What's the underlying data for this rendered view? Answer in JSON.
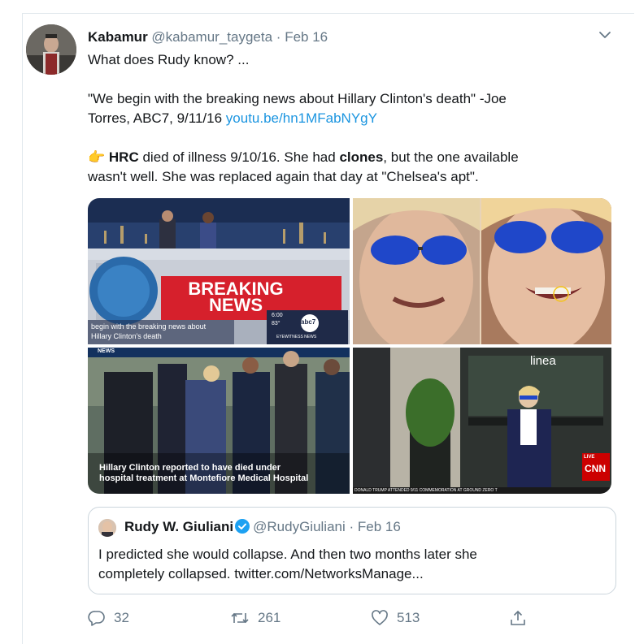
{
  "tweet": {
    "author_name": "Kabamur",
    "author_handle": "@kabamur_taygeta",
    "separator": "·",
    "date": "Feb 16",
    "line1": "What does Rudy know? ...",
    "quote_line1": "\"We begin with the breaking news about Hillary Clinton's death\" -Joe",
    "quote_line2_prefix": "Torres, ABC7, 9/11/16",
    "quote_link": "youtu.be/hn1MFabNYgY",
    "bullet_emoji": "👉",
    "hrc": "HRC",
    "line3_mid": " died of illness 9/10/16. She had ",
    "clones": "clones",
    "line3_end": ", but the one available",
    "line4": "wasn't well. She was replaced again that day at \"Chelsea's apt\"."
  },
  "media": {
    "image1": {
      "title_top": "BREAKING",
      "title_bottom": "NEWS",
      "caption_line1": "begin with the breaking news about",
      "caption_line2": "Hillary Clinton's death",
      "channel_logo": "abc7",
      "time": "6:00",
      "temp": "83°",
      "show_name": "EYEWITNESS NEWS"
    },
    "image3": {
      "nav_brand": "NEWS",
      "caption_line1": "Hillary Clinton reported to have died under",
      "caption_line2": "hospital treatment at Montefiore Medical Hospital"
    },
    "image4": {
      "storefront_sign": "linea",
      "live": "LIVE",
      "network": "CNN",
      "ticker": "DONALD TRUMP ATTENDED 9/11 COMMEMORATION AT GROUND ZERO T"
    }
  },
  "quoted_tweet": {
    "author_name": "Rudy W. Giuliani",
    "author_handle": "@RudyGiuliani",
    "separator": "·",
    "date": "Feb 16",
    "line1": "I predicted she would collapse. And then two months later she",
    "line2": "completely collapsed. twitter.com/NetworksManage..."
  },
  "actions": {
    "replies": "32",
    "retweets": "261",
    "likes": "513"
  },
  "icons": {
    "reply": "reply-icon",
    "retweet": "retweet-icon",
    "like": "heart-icon",
    "share": "share-icon",
    "menu": "chevron-down-icon",
    "verified": "verified-badge-icon"
  },
  "colors": {
    "link": "#1b95e0",
    "secondary_text": "#657786",
    "verified": "#1da1f2",
    "abc_red": "#d6202c",
    "cnn_red": "#cc0000"
  }
}
